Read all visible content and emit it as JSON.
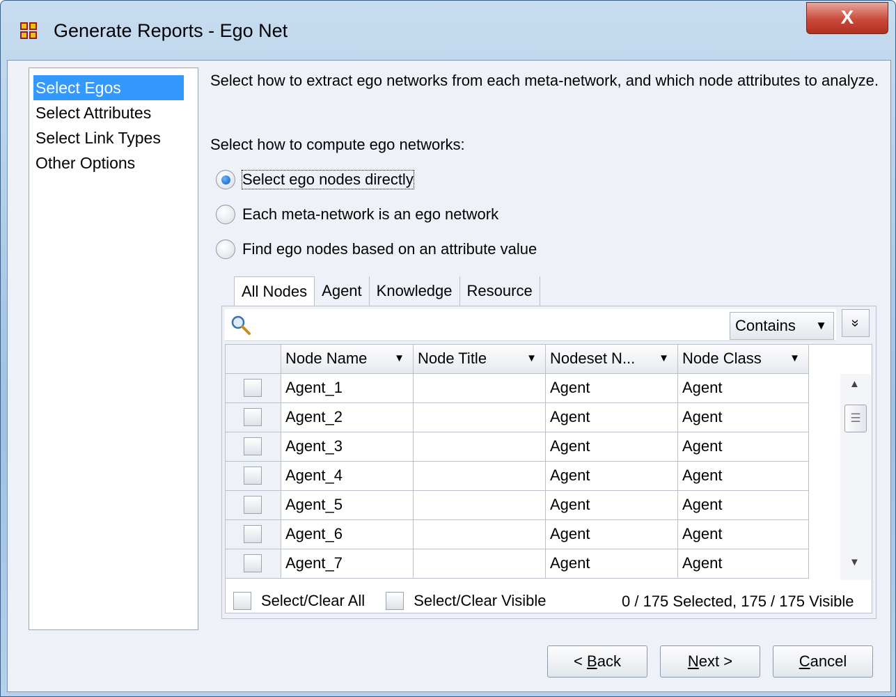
{
  "window": {
    "title": "Generate Reports - Ego Net",
    "close_label": "X"
  },
  "nav": {
    "items": [
      {
        "label": "Select Egos",
        "selected": true
      },
      {
        "label": "Select Attributes",
        "selected": false
      },
      {
        "label": "Select Link Types",
        "selected": false
      },
      {
        "label": "Other Options",
        "selected": false
      }
    ]
  },
  "main": {
    "description": "Select how to extract ego networks from each meta-network, and which node attributes to analyze.",
    "compute_label": "Select how to compute ego networks:",
    "radios": [
      {
        "label": "Select ego nodes directly",
        "checked": true
      },
      {
        "label": "Each meta-network is an ego network",
        "checked": false
      },
      {
        "label": "Find ego nodes based on an attribute value",
        "checked": false
      }
    ],
    "tabs": [
      "All Nodes",
      "Agent",
      "Knowledge",
      "Resource"
    ],
    "active_tab": "All Nodes",
    "search": {
      "placeholder": "",
      "mode": "Contains",
      "mode_arrow": "▼",
      "expand_glyph": "»"
    },
    "table": {
      "columns": [
        "Node Name",
        "Node Title",
        "Nodeset N...",
        "Node Class"
      ],
      "rows": [
        {
          "name": "Agent_1",
          "title": "",
          "nodeset": "Agent",
          "class": "Agent"
        },
        {
          "name": "Agent_2",
          "title": "",
          "nodeset": "Agent",
          "class": "Agent"
        },
        {
          "name": "Agent_3",
          "title": "",
          "nodeset": "Agent",
          "class": "Agent"
        },
        {
          "name": "Agent_4",
          "title": "",
          "nodeset": "Agent",
          "class": "Agent"
        },
        {
          "name": "Agent_5",
          "title": "",
          "nodeset": "Agent",
          "class": "Agent"
        },
        {
          "name": "Agent_6",
          "title": "",
          "nodeset": "Agent",
          "class": "Agent"
        },
        {
          "name": "Agent_7",
          "title": "",
          "nodeset": "Agent",
          "class": "Agent"
        }
      ]
    },
    "select_all_label": "Select/Clear All",
    "select_visible_label": "Select/Clear Visible",
    "status": "0 / 175 Selected, 175 / 175 Visible"
  },
  "buttons": {
    "back": {
      "prefix": "< ",
      "mnemonic": "B",
      "rest": "ack"
    },
    "next": {
      "mnemonic": "N",
      "rest": "ext >"
    },
    "cancel": {
      "mnemonic": "C",
      "rest": "ancel"
    }
  }
}
